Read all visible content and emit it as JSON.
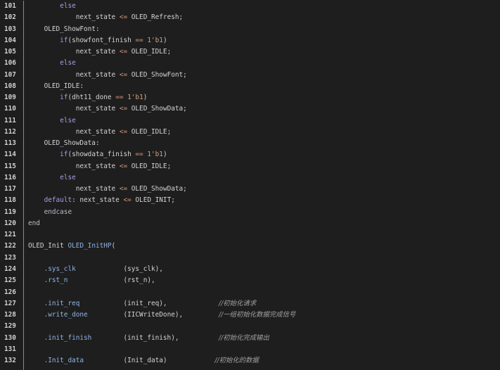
{
  "colors": {
    "background": "#1e1e1e",
    "keyword": "#a89ee0",
    "operator": "#d9977a",
    "port": "#8fb4e6",
    "comment": "#a0a0a0"
  },
  "lines": [
    {
      "n": "101",
      "tokens": [
        [
          "",
          "        "
        ],
        [
          "kw",
          "else"
        ]
      ]
    },
    {
      "n": "102",
      "tokens": [
        [
          "",
          "            "
        ],
        [
          "id",
          "next_state "
        ],
        [
          "op",
          "<="
        ],
        [
          "id",
          " OLED_Refresh;"
        ]
      ]
    },
    {
      "n": "103",
      "tokens": [
        [
          "",
          "    "
        ],
        [
          "id",
          "OLED_ShowFont:"
        ]
      ]
    },
    {
      "n": "104",
      "tokens": [
        [
          "",
          "        "
        ],
        [
          "kw",
          "if"
        ],
        [
          "id",
          "(showfont_finish "
        ],
        [
          "op",
          "=="
        ],
        [
          "id",
          " "
        ],
        [
          "num",
          "1'b1"
        ],
        [
          "id",
          ")"
        ]
      ]
    },
    {
      "n": "105",
      "tokens": [
        [
          "",
          "            "
        ],
        [
          "id",
          "next_state "
        ],
        [
          "op",
          "<="
        ],
        [
          "id",
          " OLED_IDLE;"
        ]
      ]
    },
    {
      "n": "106",
      "tokens": [
        [
          "",
          "        "
        ],
        [
          "kw",
          "else"
        ]
      ]
    },
    {
      "n": "107",
      "tokens": [
        [
          "",
          "            "
        ],
        [
          "id",
          "next_state "
        ],
        [
          "op",
          "<="
        ],
        [
          "id",
          " OLED_ShowFont;"
        ]
      ]
    },
    {
      "n": "108",
      "tokens": [
        [
          "",
          "    "
        ],
        [
          "id",
          "OLED_IDLE:"
        ]
      ]
    },
    {
      "n": "109",
      "tokens": [
        [
          "",
          "        "
        ],
        [
          "kw",
          "if"
        ],
        [
          "id",
          "(dht11_done "
        ],
        [
          "op",
          "=="
        ],
        [
          "id",
          " "
        ],
        [
          "num",
          "1'b1"
        ],
        [
          "id",
          ")"
        ]
      ]
    },
    {
      "n": "110",
      "tokens": [
        [
          "",
          "            "
        ],
        [
          "id",
          "next_state "
        ],
        [
          "op",
          "<="
        ],
        [
          "id",
          " OLED_ShowData;"
        ]
      ]
    },
    {
      "n": "111",
      "tokens": [
        [
          "",
          "        "
        ],
        [
          "kw",
          "else"
        ]
      ]
    },
    {
      "n": "112",
      "tokens": [
        [
          "",
          "            "
        ],
        [
          "id",
          "next_state "
        ],
        [
          "op",
          "<="
        ],
        [
          "id",
          " OLED_IDLE;"
        ]
      ]
    },
    {
      "n": "113",
      "tokens": [
        [
          "",
          "    "
        ],
        [
          "id",
          "OLED_ShowData:"
        ]
      ]
    },
    {
      "n": "114",
      "tokens": [
        [
          "",
          "        "
        ],
        [
          "kw",
          "if"
        ],
        [
          "id",
          "(showdata_finish "
        ],
        [
          "op",
          "=="
        ],
        [
          "id",
          " "
        ],
        [
          "num",
          "1'b1"
        ],
        [
          "id",
          ")"
        ]
      ]
    },
    {
      "n": "115",
      "tokens": [
        [
          "",
          "            "
        ],
        [
          "id",
          "next_state "
        ],
        [
          "op",
          "<="
        ],
        [
          "id",
          " OLED_IDLE;"
        ]
      ]
    },
    {
      "n": "116",
      "tokens": [
        [
          "",
          "        "
        ],
        [
          "kw",
          "else"
        ]
      ]
    },
    {
      "n": "117",
      "tokens": [
        [
          "",
          "            "
        ],
        [
          "id",
          "next_state "
        ],
        [
          "op",
          "<="
        ],
        [
          "id",
          " OLED_ShowData;"
        ]
      ]
    },
    {
      "n": "118",
      "tokens": [
        [
          "",
          "    "
        ],
        [
          "kw",
          "default"
        ],
        [
          "id",
          ": next_state "
        ],
        [
          "op",
          "<="
        ],
        [
          "id",
          " OLED_INIT;"
        ]
      ]
    },
    {
      "n": "119",
      "tokens": [
        [
          "",
          "    "
        ],
        [
          "kw2",
          "endcase"
        ]
      ]
    },
    {
      "n": "120",
      "tokens": [
        [
          "kw2",
          "end"
        ]
      ]
    },
    {
      "n": "121",
      "tokens": []
    },
    {
      "n": "122",
      "tokens": [
        [
          "id",
          "OLED_Init "
        ],
        [
          "inst",
          "OLED_InitHP"
        ],
        [
          "id",
          "("
        ]
      ]
    },
    {
      "n": "123",
      "tokens": []
    },
    {
      "n": "124",
      "tokens": [
        [
          "",
          "    "
        ],
        [
          "port",
          ".sys_clk"
        ],
        [
          "",
          "            "
        ],
        [
          "id",
          "(sys_clk),"
        ]
      ]
    },
    {
      "n": "125",
      "tokens": [
        [
          "",
          "    "
        ],
        [
          "port",
          ".rst_n"
        ],
        [
          "",
          "              "
        ],
        [
          "id",
          "(rst_n),"
        ]
      ]
    },
    {
      "n": "126",
      "tokens": []
    },
    {
      "n": "127",
      "tokens": [
        [
          "",
          "    "
        ],
        [
          "port",
          ".init_req"
        ],
        [
          "",
          "           "
        ],
        [
          "id",
          "(init_req),"
        ],
        [
          "",
          "             "
        ],
        [
          "cm",
          "//初始化请求"
        ]
      ]
    },
    {
      "n": "128",
      "tokens": [
        [
          "",
          "    "
        ],
        [
          "port",
          ".write_done"
        ],
        [
          "",
          "         "
        ],
        [
          "id",
          "(IICWriteDone),"
        ],
        [
          "",
          "         "
        ],
        [
          "cm",
          "//一组初始化数据完成信号"
        ]
      ]
    },
    {
      "n": "129",
      "tokens": []
    },
    {
      "n": "130",
      "tokens": [
        [
          "",
          "    "
        ],
        [
          "port",
          ".init_finish"
        ],
        [
          "",
          "        "
        ],
        [
          "id",
          "(init_finish),"
        ],
        [
          "",
          "          "
        ],
        [
          "cm",
          "//初始化完成输出"
        ]
      ]
    },
    {
      "n": "131",
      "tokens": []
    },
    {
      "n": "132",
      "tokens": [
        [
          "",
          "    "
        ],
        [
          "port",
          ".Init_data"
        ],
        [
          "",
          "          "
        ],
        [
          "id",
          "(Init_data)"
        ],
        [
          "",
          "            "
        ],
        [
          "cm",
          "//初始化的数据"
        ]
      ]
    }
  ]
}
